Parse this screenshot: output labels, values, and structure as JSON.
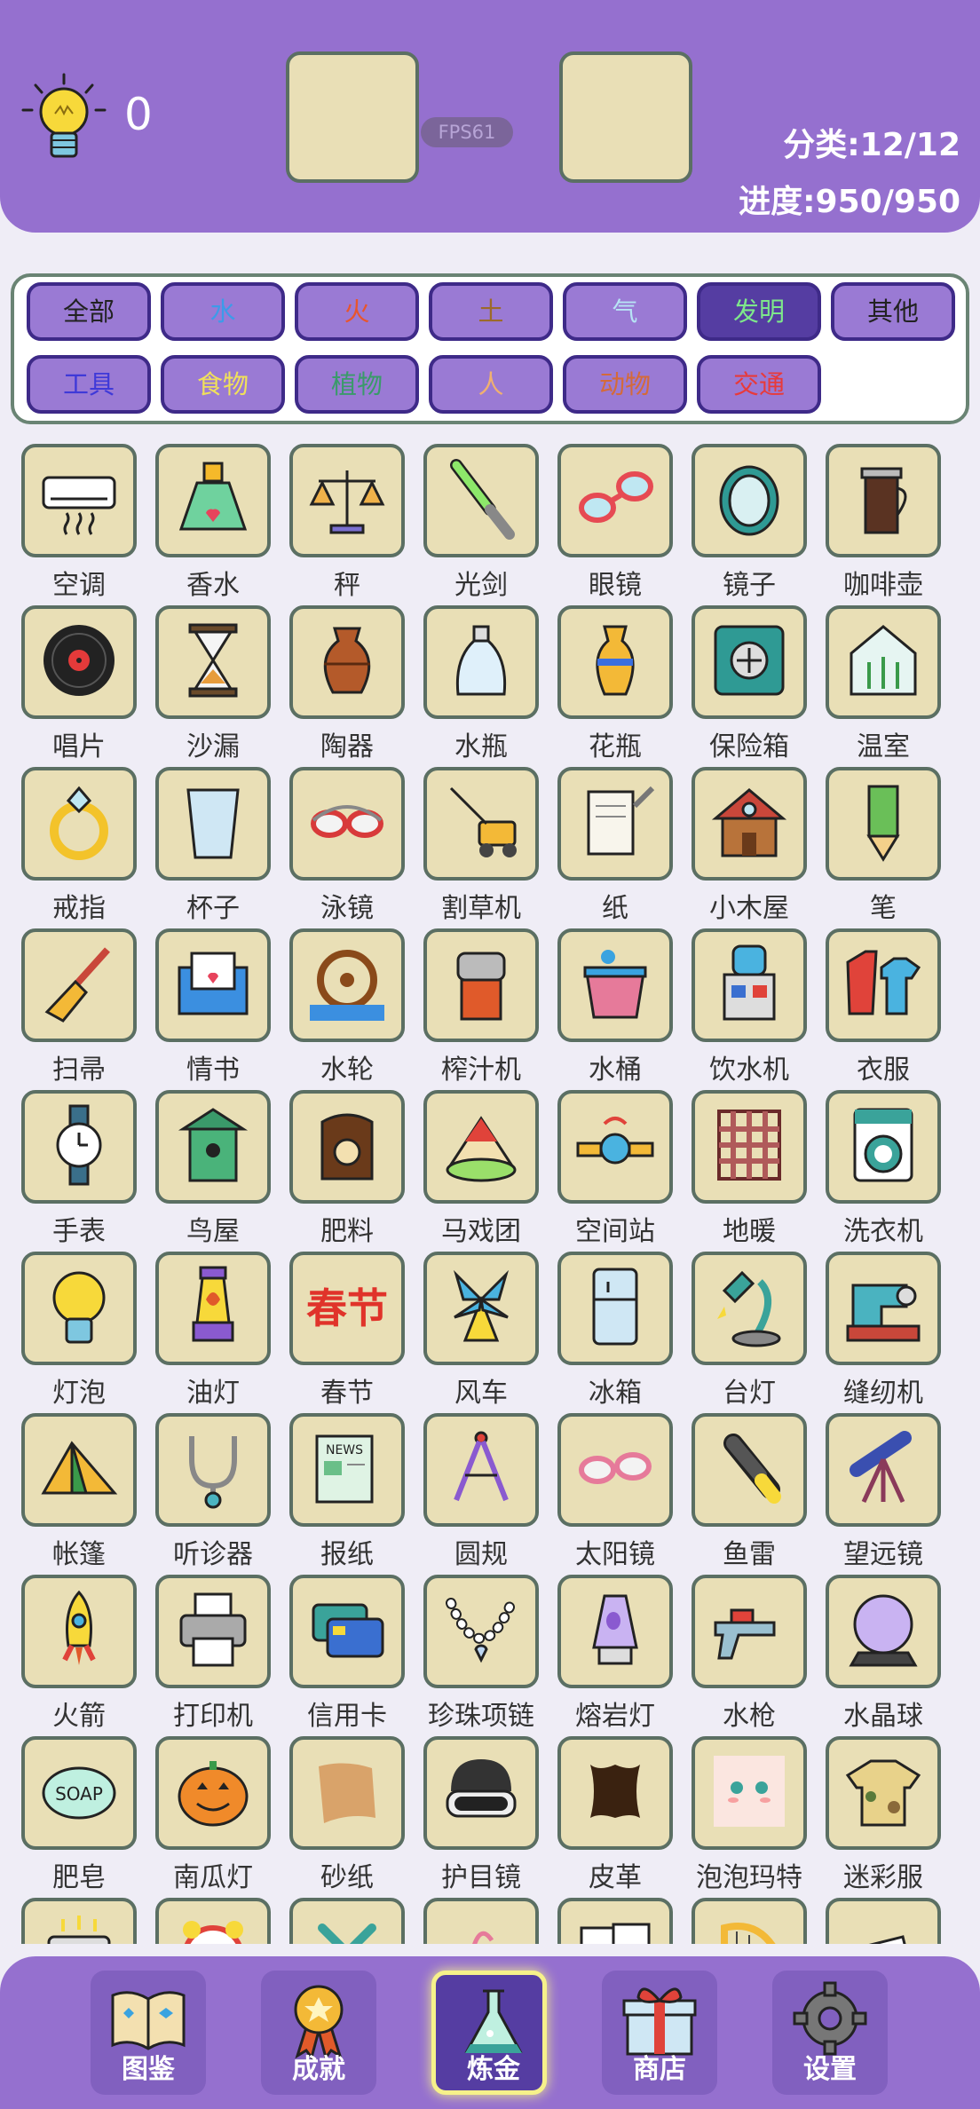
{
  "header": {
    "score": "0",
    "fps": "FPS61",
    "category": "分类:12/12",
    "progress": "进度:950/950"
  },
  "filters": [
    {
      "label": "全部",
      "color": "#222222",
      "bg": "#9a7ad4"
    },
    {
      "label": "水",
      "color": "#3d9be9",
      "bg": "#9a7ad4"
    },
    {
      "label": "火",
      "color": "#e8552d",
      "bg": "#9a7ad4"
    },
    {
      "label": "土",
      "color": "#9c6a2a",
      "bg": "#9a7ad4"
    },
    {
      "label": "气",
      "color": "#b7e3f5",
      "bg": "#9a7ad4"
    },
    {
      "label": "发明",
      "color": "#7ee88b",
      "bg": "#553da2"
    },
    {
      "label": "其他",
      "color": "#222222",
      "bg": "#9a7ad4"
    },
    {
      "label": "工具",
      "color": "#3f39d8",
      "bg": "#9a7ad4"
    },
    {
      "label": "食物",
      "color": "#f0e05a",
      "bg": "#9a7ad4"
    },
    {
      "label": "植物",
      "color": "#3a9a6a",
      "bg": "#9a7ad4"
    },
    {
      "label": "人",
      "color": "#f0b070",
      "bg": "#9a7ad4"
    },
    {
      "label": "动物",
      "color": "#d46a3a",
      "bg": "#9a7ad4"
    },
    {
      "label": "交通",
      "color": "#e83a3a",
      "bg": "#9a7ad4"
    }
  ],
  "items": [
    {
      "label": "空调",
      "icon": "air-conditioner-icon"
    },
    {
      "label": "香水",
      "icon": "perfume-icon"
    },
    {
      "label": "秤",
      "icon": "scale-icon"
    },
    {
      "label": "光剑",
      "icon": "lightsaber-icon"
    },
    {
      "label": "眼镜",
      "icon": "glasses-icon"
    },
    {
      "label": "镜子",
      "icon": "mirror-icon"
    },
    {
      "label": "咖啡壶",
      "icon": "coffee-pot-icon"
    },
    {
      "label": "唱片",
      "icon": "vinyl-record-icon"
    },
    {
      "label": "沙漏",
      "icon": "hourglass-icon"
    },
    {
      "label": "陶器",
      "icon": "pottery-icon"
    },
    {
      "label": "水瓶",
      "icon": "water-bottle-icon"
    },
    {
      "label": "花瓶",
      "icon": "vase-icon"
    },
    {
      "label": "保险箱",
      "icon": "safe-icon"
    },
    {
      "label": "温室",
      "icon": "greenhouse-icon"
    },
    {
      "label": "戒指",
      "icon": "ring-icon"
    },
    {
      "label": "杯子",
      "icon": "cup-icon"
    },
    {
      "label": "泳镜",
      "icon": "swim-goggles-icon"
    },
    {
      "label": "割草机",
      "icon": "lawn-mower-icon"
    },
    {
      "label": "纸",
      "icon": "paper-icon"
    },
    {
      "label": "小木屋",
      "icon": "cabin-icon"
    },
    {
      "label": "笔",
      "icon": "pen-icon"
    },
    {
      "label": "扫帚",
      "icon": "broom-icon"
    },
    {
      "label": "情书",
      "icon": "love-letter-icon"
    },
    {
      "label": "水轮",
      "icon": "water-wheel-icon"
    },
    {
      "label": "榨汁机",
      "icon": "juicer-icon"
    },
    {
      "label": "水桶",
      "icon": "bucket-icon"
    },
    {
      "label": "饮水机",
      "icon": "water-dispenser-icon"
    },
    {
      "label": "衣服",
      "icon": "clothes-icon"
    },
    {
      "label": "手表",
      "icon": "watch-icon"
    },
    {
      "label": "鸟屋",
      "icon": "birdhouse-icon"
    },
    {
      "label": "肥料",
      "icon": "fertilizer-icon"
    },
    {
      "label": "马戏团",
      "icon": "circus-icon"
    },
    {
      "label": "空间站",
      "icon": "space-station-icon"
    },
    {
      "label": "地暖",
      "icon": "floor-heating-icon"
    },
    {
      "label": "洗衣机",
      "icon": "washing-machine-icon"
    },
    {
      "label": "灯泡",
      "icon": "light-bulb-icon"
    },
    {
      "label": "油灯",
      "icon": "oil-lamp-icon"
    },
    {
      "label": "春节",
      "icon": "spring-festival-icon"
    },
    {
      "label": "风车",
      "icon": "windmill-icon"
    },
    {
      "label": "冰箱",
      "icon": "fridge-icon"
    },
    {
      "label": "台灯",
      "icon": "desk-lamp-icon"
    },
    {
      "label": "缝纫机",
      "icon": "sewing-machine-icon"
    },
    {
      "label": "帐篷",
      "icon": "tent-icon"
    },
    {
      "label": "听诊器",
      "icon": "stethoscope-icon"
    },
    {
      "label": "报纸",
      "icon": "newspaper-icon"
    },
    {
      "label": "圆规",
      "icon": "compass-icon"
    },
    {
      "label": "太阳镜",
      "icon": "sunglasses-icon"
    },
    {
      "label": "鱼雷",
      "icon": "torpedo-icon"
    },
    {
      "label": "望远镜",
      "icon": "telescope-icon"
    },
    {
      "label": "火箭",
      "icon": "rocket-icon"
    },
    {
      "label": "打印机",
      "icon": "printer-icon"
    },
    {
      "label": "信用卡",
      "icon": "credit-card-icon"
    },
    {
      "label": "珍珠项链",
      "icon": "pearl-necklace-icon"
    },
    {
      "label": "熔岩灯",
      "icon": "lava-lamp-icon"
    },
    {
      "label": "水枪",
      "icon": "water-gun-icon"
    },
    {
      "label": "水晶球",
      "icon": "crystal-ball-icon"
    },
    {
      "label": "肥皂",
      "icon": "soap-icon"
    },
    {
      "label": "南瓜灯",
      "icon": "jack-o-lantern-icon"
    },
    {
      "label": "砂纸",
      "icon": "sandpaper-icon"
    },
    {
      "label": "护目镜",
      "icon": "goggles-icon"
    },
    {
      "label": "皮革",
      "icon": "leather-icon"
    },
    {
      "label": "泡泡玛特",
      "icon": "popmart-icon"
    },
    {
      "label": "迷彩服",
      "icon": "camouflage-icon"
    },
    {
      "label": "",
      "icon": "toaster-icon"
    },
    {
      "label": "",
      "icon": "alarm-clock-icon"
    },
    {
      "label": "",
      "icon": "propeller-icon"
    },
    {
      "label": "",
      "icon": "unknown-icon"
    },
    {
      "label": "",
      "icon": "sheet-music-icon"
    },
    {
      "label": "",
      "icon": "harp-icon"
    },
    {
      "label": "",
      "icon": "paper-scrap-icon"
    }
  ],
  "nav": [
    {
      "label": "图鉴",
      "icon": "book-icon",
      "active": false
    },
    {
      "label": "成就",
      "icon": "medal-icon",
      "active": false
    },
    {
      "label": "炼金",
      "icon": "flask-icon",
      "active": true
    },
    {
      "label": "商店",
      "icon": "gift-icon",
      "active": false
    },
    {
      "label": "设置",
      "icon": "gear-icon",
      "active": false
    }
  ]
}
